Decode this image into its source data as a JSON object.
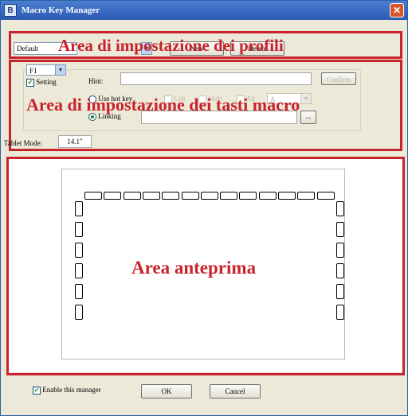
{
  "window": {
    "title": "Macro Key Manager",
    "icon_label": "B"
  },
  "profile": {
    "selected": "Default",
    "buttons": [
      "New",
      "Delete"
    ]
  },
  "macro": {
    "key_selected": "F1",
    "setting_label": "Setting",
    "setting_checked": true,
    "hint_label": "Hint:",
    "hint_value": "",
    "confirm_label": "Confirm",
    "use_hot_key_label": "Use hot key",
    "modifiers": [
      "Ctrl",
      "Shift",
      "Alt"
    ],
    "hotkey_value": "A",
    "linking_label": "Linking",
    "linking_selected": true,
    "browse_label": "..."
  },
  "tablet_mode": {
    "label": "Tablet Mode:",
    "value": "14.1\""
  },
  "callouts": {
    "profiles": "Area di impostazione dei profili",
    "macro_keys": "Area di impostazione dei tasti macro",
    "preview": "Area anteprima"
  },
  "footer": {
    "enable_label": "Enable this manager",
    "enable_checked": true,
    "ok_label": "OK",
    "cancel_label": "Cancel"
  },
  "colors": {
    "callout_red": "#c8232c",
    "title_blue": "#2b59b4"
  }
}
